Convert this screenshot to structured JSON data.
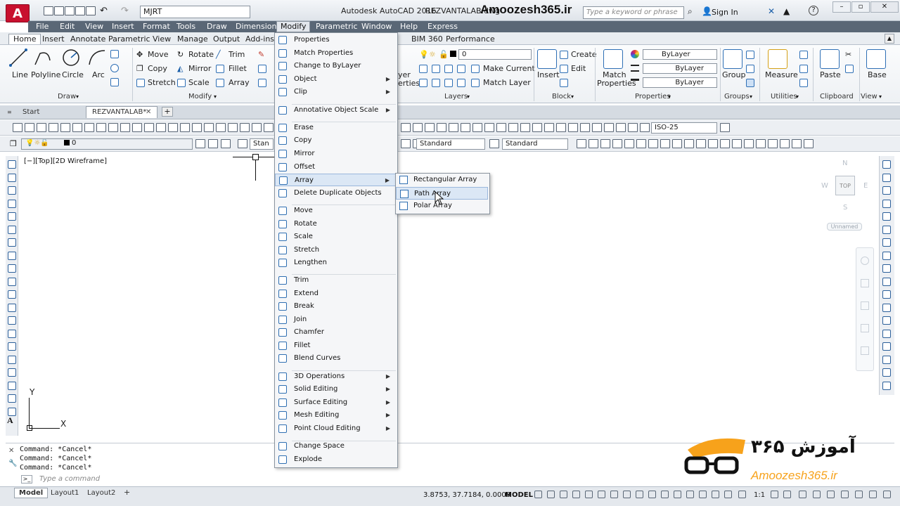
{
  "window": {
    "app_title": "Autodesk AutoCAD 2016",
    "doc_title": "REZVANTALAB.dwg",
    "brand": "Amoozesh365.ir",
    "workspace": "MJRT",
    "search_placeholder": "Type a keyword or phrase",
    "sign_in": "Sign In",
    "logo_letter": "A"
  },
  "menubar": {
    "items": [
      "File",
      "Edit",
      "View",
      "Insert",
      "Format",
      "Tools",
      "Draw",
      "Dimension",
      "Modify",
      "Parametric",
      "Window",
      "Help",
      "Express"
    ],
    "active": "Modify"
  },
  "ribbon_tabs": {
    "items": [
      "Home",
      "Insert",
      "Annotate",
      "Parametric",
      "View",
      "Manage",
      "Output",
      "Add-ins",
      "BIM 360",
      "Performance"
    ],
    "active": "Home"
  },
  "ribbon": {
    "draw": {
      "title": "Draw",
      "line": "Line",
      "polyline": "Polyline",
      "circle": "Circle",
      "arc": "Arc"
    },
    "modify": {
      "title": "Modify",
      "move": "Move",
      "rotate": "Rotate",
      "trim": "Trim",
      "copy": "Copy",
      "mirror": "Mirror",
      "fillet": "Fillet",
      "stretch": "Stretch",
      "scale": "Scale",
      "array": "Array"
    },
    "layers": {
      "title": "Layers",
      "combo": "0",
      "make_current": "Make Current",
      "match_layer": "Match Layer",
      "properties_partial": "yer",
      "properties_partial2": "erties"
    },
    "block": {
      "title": "Block",
      "insert": "Insert",
      "create": "Create",
      "edit": "Edit"
    },
    "properties": {
      "title": "Properties",
      "match": "Match",
      "match2": "Properties",
      "color": "ByLayer",
      "linetype": "ByLayer",
      "lineweight": "ByLayer"
    },
    "groups": {
      "title": "Groups",
      "group": "Group"
    },
    "utilities": {
      "title": "Utilities",
      "measure": "Measure"
    },
    "clipboard": {
      "title": "Clipboard",
      "paste": "Paste"
    },
    "view": {
      "title": "View",
      "base": "Base"
    }
  },
  "file_tabs": {
    "start": "Start",
    "doc": "REZVANTALAB*",
    "add": "+"
  },
  "toolbars": {
    "dimstyle": "ISO-25",
    "layer_combo": "0",
    "textstyle_partial": "Stan",
    "textstyle": "Standard",
    "tablestyle": "Standard"
  },
  "viewport": {
    "label": "[−][Top][2D Wireframe]",
    "viewcube_top": "TOP",
    "north": "N",
    "west": "W",
    "east": "E",
    "south": "S",
    "unnamed": "Unnamed",
    "ucs_x": "X",
    "ucs_y": "Y"
  },
  "modify_menu": {
    "items": [
      {
        "label": "Properties",
        "sub": false
      },
      {
        "label": "Match Properties",
        "sub": false
      },
      {
        "label": "Change to ByLayer",
        "sub": false
      },
      {
        "label": "Object",
        "sub": true
      },
      {
        "label": "Clip",
        "sub": true
      },
      {
        "label": "Annotative Object Scale",
        "sub": true
      },
      {
        "label": "Erase",
        "sub": false
      },
      {
        "label": "Copy",
        "sub": false
      },
      {
        "label": "Mirror",
        "sub": false
      },
      {
        "label": "Offset",
        "sub": false
      },
      {
        "label": "Array",
        "sub": true
      },
      {
        "label": "Delete Duplicate Objects",
        "sub": false
      },
      {
        "label": "Move",
        "sub": false
      },
      {
        "label": "Rotate",
        "sub": false
      },
      {
        "label": "Scale",
        "sub": false
      },
      {
        "label": "Stretch",
        "sub": false
      },
      {
        "label": "Lengthen",
        "sub": false
      },
      {
        "label": "Trim",
        "sub": false
      },
      {
        "label": "Extend",
        "sub": false
      },
      {
        "label": "Break",
        "sub": false
      },
      {
        "label": "Join",
        "sub": false
      },
      {
        "label": "Chamfer",
        "sub": false
      },
      {
        "label": "Fillet",
        "sub": false
      },
      {
        "label": "Blend Curves",
        "sub": false
      },
      {
        "label": "3D Operations",
        "sub": true
      },
      {
        "label": "Solid Editing",
        "sub": true
      },
      {
        "label": "Surface Editing",
        "sub": true
      },
      {
        "label": "Mesh Editing",
        "sub": true
      },
      {
        "label": "Point Cloud Editing",
        "sub": true
      },
      {
        "label": "Change Space",
        "sub": false
      },
      {
        "label": "Explode",
        "sub": false
      }
    ],
    "highlighted": "Array"
  },
  "array_submenu": {
    "items": [
      "Rectangular Array",
      "Path Array",
      "Polar Array"
    ],
    "highlighted": "Path Array"
  },
  "command_line": {
    "history": [
      "Command: *Cancel*",
      "Command: *Cancel*",
      "Command: *Cancel*"
    ],
    "placeholder": "Type a command"
  },
  "status_bar": {
    "tabs": [
      "Model",
      "Layout1",
      "Layout2"
    ],
    "active": "Model",
    "add": "+",
    "coords": "3.8753, 37.7184, 0.0000",
    "model": "MODEL",
    "scale": "1:1"
  },
  "watermark": {
    "persian": "آموزش ۳۶۵",
    "latin": "Amoozesh365.ir"
  }
}
